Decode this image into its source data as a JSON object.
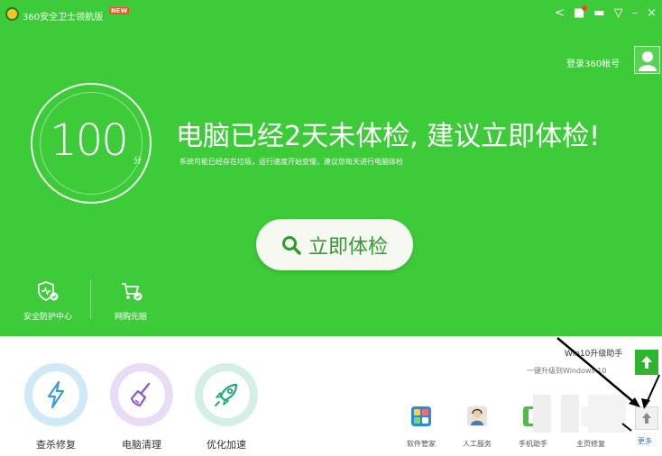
{
  "titlebar": {
    "app_title": "360安全卫士领航版",
    "new_badge": "NEW",
    "controls": [
      "<",
      "■",
      "▬",
      "▽",
      "–",
      "×"
    ]
  },
  "account": {
    "login_label": "登录360帐号"
  },
  "score": {
    "value": "100",
    "unit": "分"
  },
  "headline": "电脑已经2天未体检, 建议立即体检!",
  "subline": "系统可能已经存在垃圾，运行速度开始变慢，建议您每天进行电脑体检",
  "scan_button": {
    "label": "立即体检"
  },
  "left_tools": [
    {
      "label": "安全防护中心",
      "icon": "shield-icon"
    },
    {
      "label": "网购先赔",
      "icon": "cart-icon"
    }
  ],
  "main_tools": [
    {
      "label": "查杀修复",
      "icon": "lightning-icon",
      "ring": "#cfe9f7",
      "color": "#3a9bd8"
    },
    {
      "label": "电脑清理",
      "icon": "broom-icon",
      "ring": "#e9dcf5",
      "color": "#8b5cc9"
    },
    {
      "label": "优化加速",
      "icon": "rocket-icon",
      "ring": "#d4f0e6",
      "color": "#26a57a"
    }
  ],
  "small_tools": [
    {
      "label": "软件管家",
      "icon": "software-manager-icon"
    },
    {
      "label": "人工服务",
      "icon": "customer-service-icon"
    },
    {
      "label": "手机助手",
      "icon": "phone-assistant-icon"
    },
    {
      "label": "主页修复",
      "icon": "homepage-repair-icon"
    }
  ],
  "win10": {
    "title": "Win10升级助手",
    "subtitle": "一键升级到Windows 10"
  },
  "more_label": "更多",
  "colors": {
    "brand_green": "#3ecb3a",
    "accent_blue": "#2f6fd8"
  }
}
